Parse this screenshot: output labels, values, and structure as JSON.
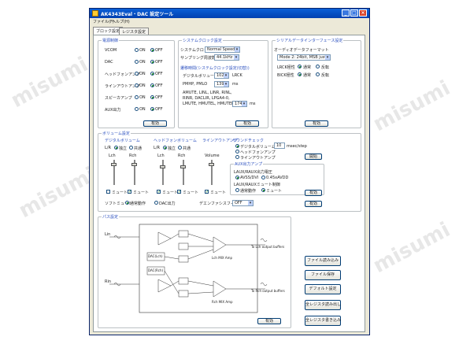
{
  "window": {
    "title": "AK4343Eval・DAC 設定ツール"
  },
  "menu": {
    "file": "ファイル(F)",
    "help": "ヘルプ(H)"
  },
  "tabs": [
    {
      "label": "ブロック設定"
    },
    {
      "label": "レジスタ設定"
    }
  ],
  "power": {
    "title": "電源制御",
    "rows": [
      {
        "label": "VCOM",
        "selected": "OFF"
      },
      {
        "label": "DAC",
        "selected": "OFF"
      },
      {
        "label": "ヘッドフォンアンプ",
        "selected": "OFF"
      },
      {
        "label": "ラインアウトアンプ",
        "selected": "OFF"
      },
      {
        "label": "スピーカアンプ",
        "selected": "OFF"
      },
      {
        "label": "AUX出力",
        "selected": "OFF"
      }
    ],
    "on_label": "ON",
    "off_label": "OFF",
    "apply": "有効"
  },
  "system": {
    "title": "システムクロック設定",
    "clock_label": "システムクロック",
    "clock_value": "Normal Speed",
    "fs_label": "サンプリング周波数",
    "fs_value": "44.1kHz",
    "sub_title": "遷移時間(システムクロック設定(切替))",
    "dvol_label": "デジタルボリューム",
    "dvol_value": "1020",
    "dvol_unit": "LRCK",
    "pmhp_label": "PMHP, PMLO",
    "pmhp_value": "139",
    "pmhp_unit": "ms",
    "amute_lines": [
      "AMUTE, LINL, LINR, RINL,",
      "RINR, DACLIR, LPGA4-0,",
      "LMUTE, HMUTEL, HMUTER"
    ],
    "amute_value": "174",
    "amute_unit": "ms",
    "apply": "有効"
  },
  "serial": {
    "title": "シリアルデータインターフェース設定",
    "format_label": "オーディオデータフォーマット",
    "format_value": "Mode 2: 24bit, MSB justified",
    "lrck_label": "LRCK極性",
    "bick_label": "BICK極性",
    "normal": "通常",
    "invert": "反転",
    "apply": "有効"
  },
  "volume": {
    "title": "ボリューム設定",
    "dvol_title": "デジタルボリューム",
    "hp_title": "ヘッドフォンボリューム",
    "line_title": "ラインアウトアンプ",
    "lr": "L/R",
    "indep": "独立",
    "common": "共通",
    "lch": "Lch",
    "rch": "Rch",
    "volume": "Volume",
    "mute": "ミュート",
    "softmute": "ソフトミュート",
    "sm_normal": "通常動作",
    "sm_dac": "DAC出力",
    "sound_title": "サウンドチェック",
    "sound_dvol": "デジタルボリューム",
    "sound_hp": "ヘッドフォンアンプ",
    "sound_line": "ラインアウトアンプ",
    "sound_value": "10",
    "sound_unit": "msec/step",
    "sound_btn": "開始",
    "aux_title": "AUX出力アンプ",
    "aux_subtitle": "LAUX/RAUX出力電圧",
    "aux_opt1": "AVSS/DVI",
    "aux_opt2": "0.45xAVDD",
    "aux_mute_title": "LAUX/RAUXミュート制御",
    "aux_normal": "通常動作",
    "aux_mute": "ミュート",
    "deemph_label": "デエンファシスフィルタ",
    "deemph_value": "OFF",
    "apply": "有効"
  },
  "path": {
    "title": "パス設定",
    "lin": "Lin",
    "rin": "Rin",
    "dac_l": "DAC(Lch)",
    "dac_r": "DAC(Rch)",
    "out_l": "To Lch output buffers",
    "out_r": "To Rch output buffers",
    "amp_l": "Lch MIX Amp",
    "amp_r": "Rch MIX Amp",
    "apply": "有効"
  },
  "side_buttons": [
    {
      "label": "ファイル読み込み"
    },
    {
      "label": "ファイル保存"
    },
    {
      "label": "デフォルト設定"
    },
    {
      "label": "全レジスタ読み出し"
    },
    {
      "label": "全レジスタ書き込み"
    }
  ]
}
